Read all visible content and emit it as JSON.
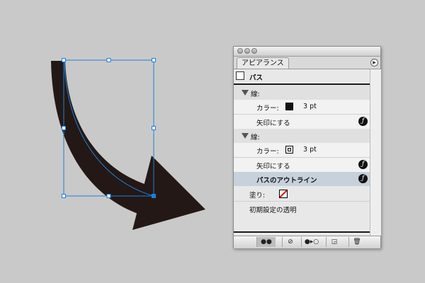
{
  "canvas": {
    "artwork": "arrow-path",
    "stroke_color": "#231815",
    "selection_color": "#1e7fd8"
  },
  "panel": {
    "tab_label": "アピアランス",
    "item_header": "パス",
    "rows": [
      {
        "label": "線:"
      },
      {
        "label": "カラー:",
        "value": "3 pt",
        "swatch": "black"
      },
      {
        "label": "矢印にする",
        "fx": true
      },
      {
        "label": "線:"
      },
      {
        "label": "カラー:",
        "value": "3 pt",
        "swatch": "double-outline"
      },
      {
        "label": "矢印にする",
        "fx": true
      },
      {
        "label": "パスのアウトライン",
        "fx": true,
        "selected": true
      },
      {
        "label": "塗り:",
        "swatch": "none"
      },
      {
        "label": "初期設定の透明"
      }
    ],
    "fx_glyph": "ƒ",
    "colors": {
      "selected_row": "#c7d1dc",
      "panel_bg": "#e8e8e8"
    },
    "bottom_buttons": [
      "new-art-maintains-appearance-icon",
      "clear-appearance-icon",
      "reduce-to-basic-icon",
      "duplicate-item-icon",
      "trash-icon"
    ]
  }
}
